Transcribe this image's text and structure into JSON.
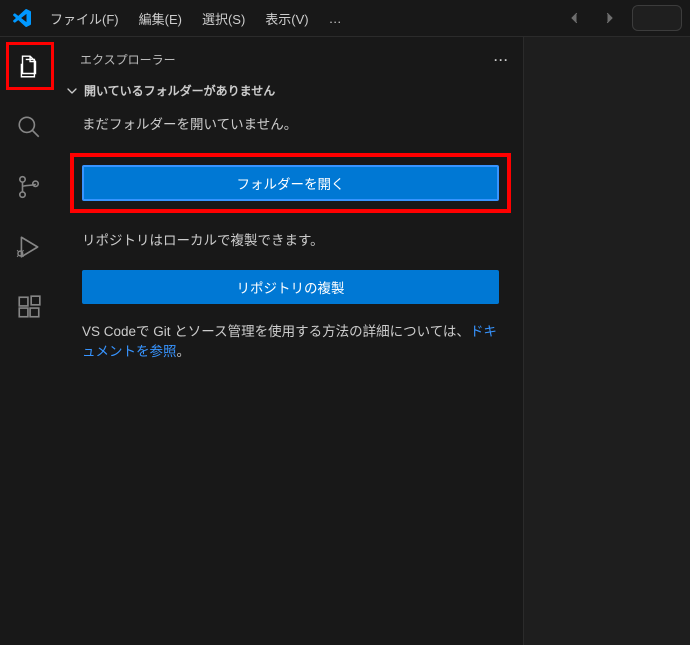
{
  "menu": {
    "file": "ファイル(F)",
    "edit": "編集(E)",
    "selection": "選択(S)",
    "view": "表示(V)",
    "overflow": "…"
  },
  "sidebar": {
    "title": "エクスプローラー",
    "more": "···",
    "section_header": "開いているフォルダーがありません",
    "no_folder_text": "まだフォルダーを開いていません。",
    "open_folder_btn": "フォルダーを開く",
    "clone_repo_text": "リポジトリはローカルで複製できます。",
    "clone_repo_btn": "リポジトリの複製",
    "docs_text_prefix": "VS Codeで Git とソース管理を使用する方法の詳細については、",
    "docs_link": "ドキュメントを参照",
    "docs_text_suffix": "。"
  }
}
